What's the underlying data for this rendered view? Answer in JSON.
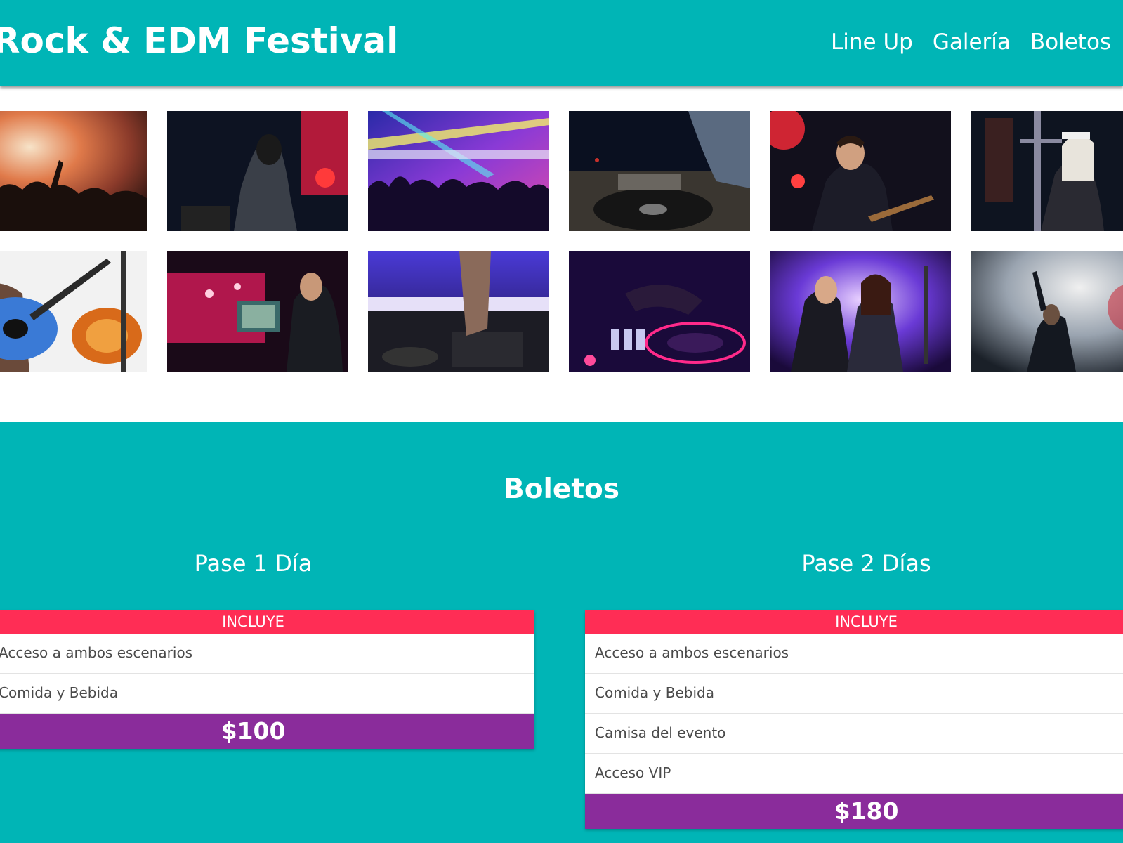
{
  "header": {
    "title": "Rock & EDM Festival",
    "nav": [
      "Line Up",
      "Galería",
      "Boletos"
    ]
  },
  "gallery": {
    "photos": [
      "concert-crowd-photo",
      "rock-singer-photo",
      "edm-crowd-lights-photo",
      "dj-turntable-photo",
      "guitarist-red-light-photo",
      "female-guitarist-photo",
      "guitar-players-photo",
      "dj-laptop-photo",
      "dj-mixer-photo",
      "dj-hand-neon-photo",
      "rock-duo-photo",
      "singer-smoke-photo"
    ]
  },
  "tickets": {
    "title": "Boletos",
    "includes_label": "INCLUYE",
    "passes": [
      {
        "name": "Pase 1 Día",
        "features": [
          "Acceso a ambos escenarios",
          "Comida y Bebida"
        ],
        "price": "$100"
      },
      {
        "name": "Pase 2 Días",
        "features": [
          "Acceso a ambos escenarios",
          "Comida y Bebida",
          "Camisa del evento",
          "Acceso VIP"
        ],
        "price": "$180"
      }
    ]
  },
  "colors": {
    "teal": "#00b5b6",
    "pink": "#ff2d55",
    "purple": "#8a2c9b"
  }
}
